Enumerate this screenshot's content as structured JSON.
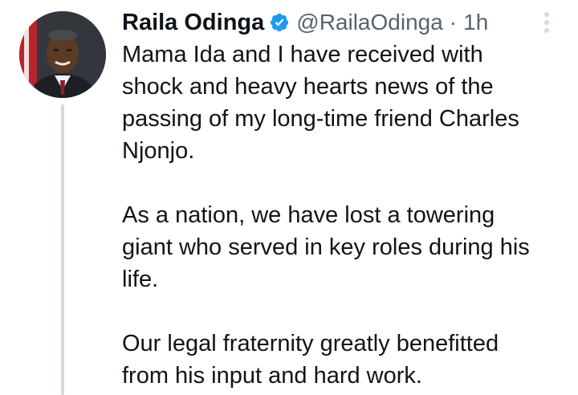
{
  "tweet": {
    "author_name": "Raila Odinga",
    "handle": "@RailaOdinga",
    "separator": "·",
    "time": "1h",
    "verified": true,
    "avatar_icon": "profile-photo",
    "more_icon": "more-vertical-icon",
    "paragraphs": [
      {
        "lines": [
          "Mama Ida and I have received with",
          "shock and heavy hearts news of the",
          "passing of my long-time friend Charles",
          "Njonjo."
        ]
      },
      {
        "lines": [
          "As a nation, we have lost a towering",
          "giant who served in key roles during his",
          "life."
        ]
      },
      {
        "lines": [
          "Our legal fraternity greatly benefitted",
          "from his input and hard work."
        ]
      }
    ]
  },
  "colors": {
    "text": "#0f1419",
    "secondary": "#536471",
    "verified_badge": "#1d9bf0",
    "thread_line": "#cfd9de"
  }
}
